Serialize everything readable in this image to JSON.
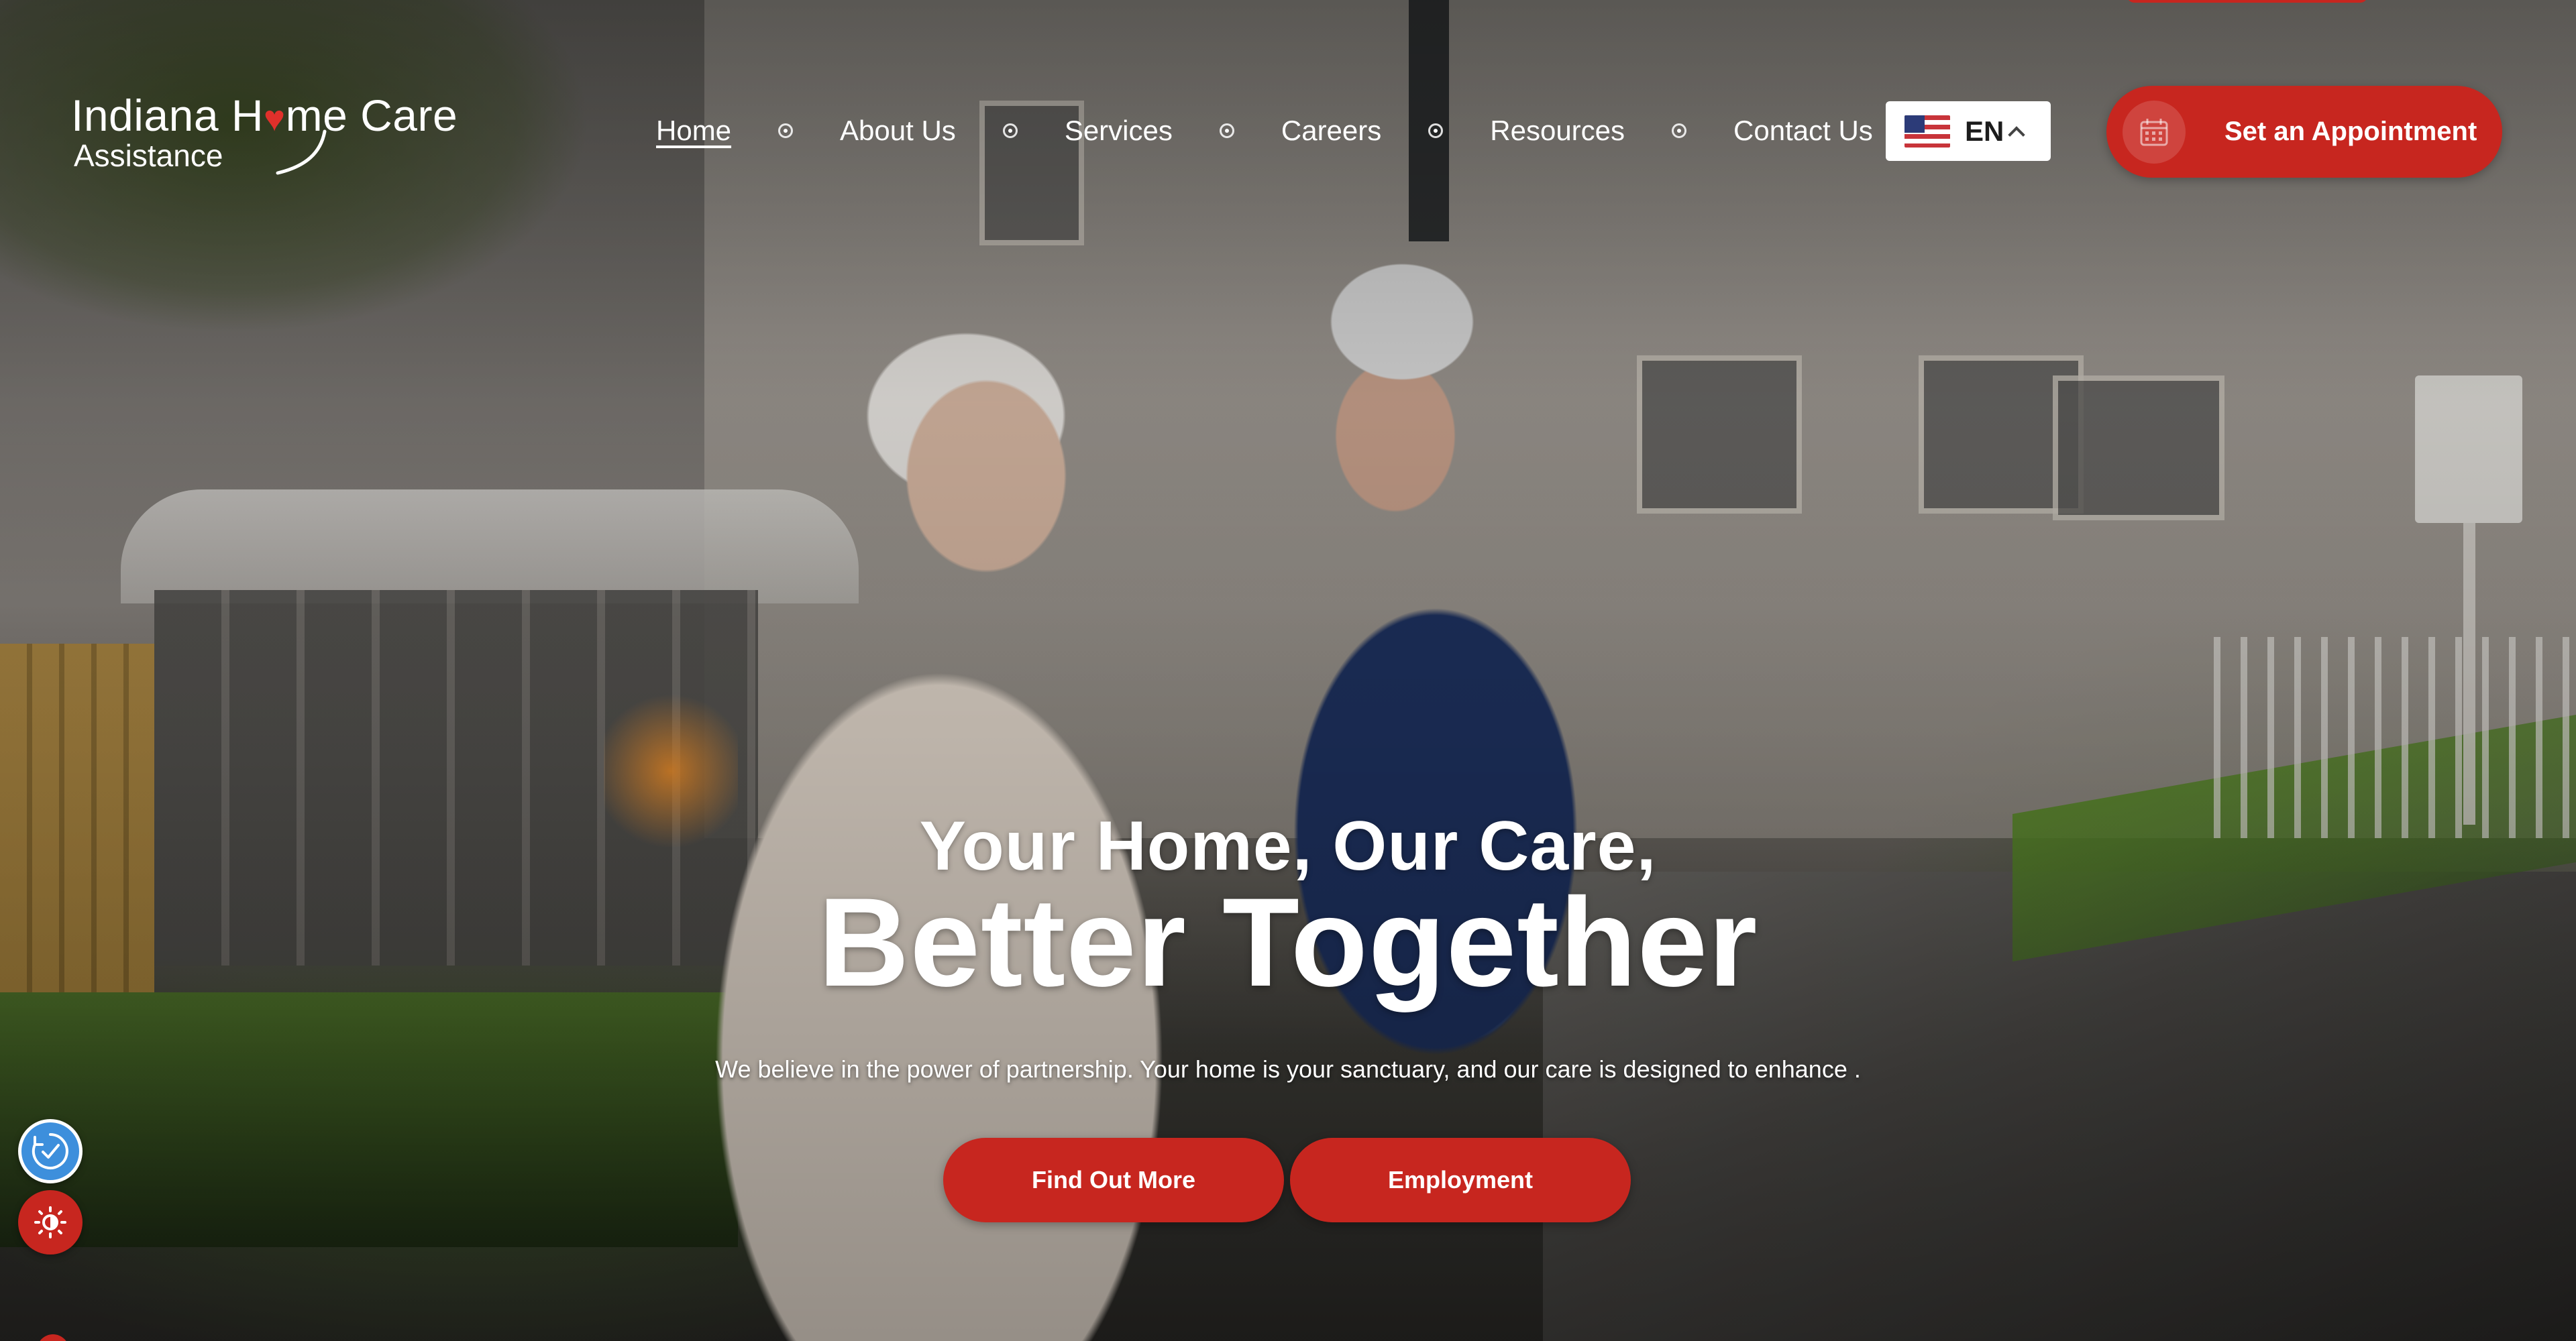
{
  "brand": {
    "name_main_prefix": "Indiana H",
    "name_main_heart": "♥",
    "name_main_suffix": "me Care",
    "name_sub": "Assistance",
    "accent_color": "#c7261f"
  },
  "nav": {
    "items": [
      {
        "label": "Home",
        "active": true
      },
      {
        "label": "About Us",
        "active": false
      },
      {
        "label": "Services",
        "active": false
      },
      {
        "label": "Careers",
        "active": false
      },
      {
        "label": "Resources",
        "active": false
      },
      {
        "label": "Contact Us",
        "active": false
      }
    ]
  },
  "language": {
    "code": "EN",
    "flag_icon": "us-flag-icon"
  },
  "header_cta": {
    "label": "Set an Appointment",
    "icon": "calendar-icon"
  },
  "hero": {
    "kicker": "Your Home, Our Care,",
    "title": "Better Together",
    "subtitle": "We believe in the power of partnership. Your home is your sanctuary, and our care is designed to enhance .",
    "buttons": {
      "primary": "Find Out More",
      "secondary": "Employment"
    }
  },
  "widgets": {
    "accessibility_icon": "accessibility-check-icon",
    "contrast_icon": "contrast-toggle-icon"
  }
}
